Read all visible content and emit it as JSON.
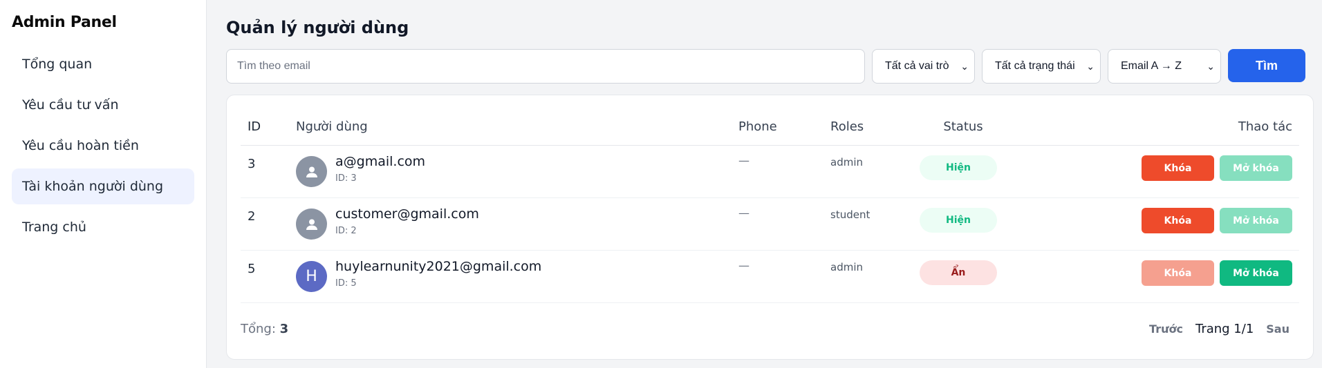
{
  "sidebar": {
    "brand": "Admin Panel",
    "items": [
      {
        "label": "Tổng quan",
        "active": false
      },
      {
        "label": "Yêu cầu tư vấn",
        "active": false
      },
      {
        "label": "Yêu cầu hoàn tiền",
        "active": false
      },
      {
        "label": "Tài khoản người dùng",
        "active": true
      },
      {
        "label": "Trang chủ",
        "active": false
      }
    ]
  },
  "main": {
    "title": "Quản lý người dùng",
    "search": {
      "placeholder": "Tìm theo email",
      "value": ""
    },
    "filters": {
      "role": "Tất cả vai trò",
      "status": "Tất cả trạng thái",
      "sort": "Email A → Z"
    },
    "search_button": "Tìm"
  },
  "table": {
    "headers": {
      "id": "ID",
      "user": "Người dùng",
      "phone": "Phone",
      "roles": "Roles",
      "status": "Status",
      "actions": "Thao tác"
    },
    "rows": [
      {
        "id": "3",
        "email": "a@gmail.com",
        "sub": "ID: 3",
        "phone": "—",
        "role": "admin",
        "status": "Hiện",
        "avatar": "person-icon"
      },
      {
        "id": "2",
        "email": "customer@gmail.com",
        "sub": "ID: 2",
        "phone": "—",
        "role": "student",
        "status": "Hiện",
        "avatar": "person-icon"
      },
      {
        "id": "5",
        "email": "huylearnunity2021@gmail.com",
        "sub": "ID: 5",
        "phone": "—",
        "role": "admin",
        "status": "Ẩn",
        "avatar": "H"
      }
    ],
    "lock_label": "Khóa",
    "unlock_label": "Mở khóa"
  },
  "footer": {
    "total_label": "Tổng:",
    "total_value": "3",
    "prev": "Trước",
    "page": "Trang 1/1",
    "next": "Sau"
  },
  "colors": {
    "primary": "#2563eb",
    "lock": "#ee4b2b",
    "unlock": "#10b981",
    "badge_show": "#ecfdf5",
    "badge_hide": "#fde2e2"
  }
}
